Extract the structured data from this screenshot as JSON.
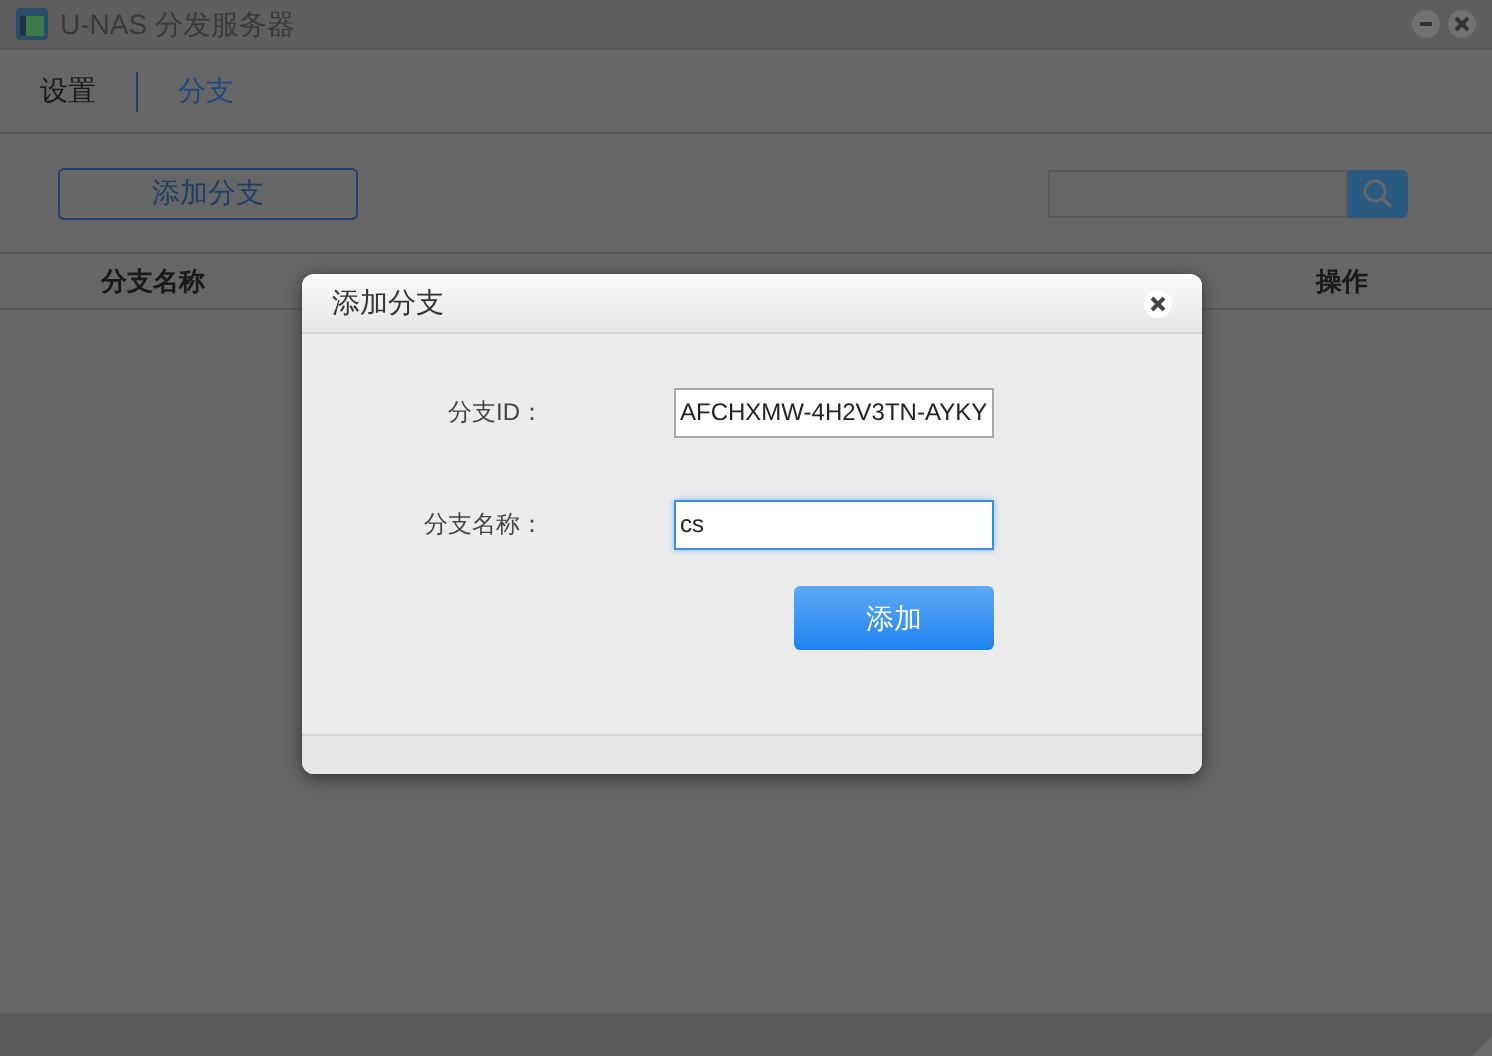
{
  "window": {
    "title": "U-NAS 分发服务器"
  },
  "tabs": [
    {
      "label": "设置",
      "selected": false
    },
    {
      "label": "分支",
      "selected": true
    }
  ],
  "toolbar": {
    "add_button": "添加分支"
  },
  "table": {
    "columns": [
      {
        "label": "分支名称"
      },
      {
        "label": "操作"
      }
    ]
  },
  "dialog": {
    "title": "添加分支",
    "fields": [
      {
        "label": "分支ID：",
        "value": "AFCHXMW-4H2V3TN-AYKY",
        "focused": false
      },
      {
        "label": "分支名称：",
        "value": "cs",
        "focused": true
      }
    ],
    "submit": "添加"
  }
}
